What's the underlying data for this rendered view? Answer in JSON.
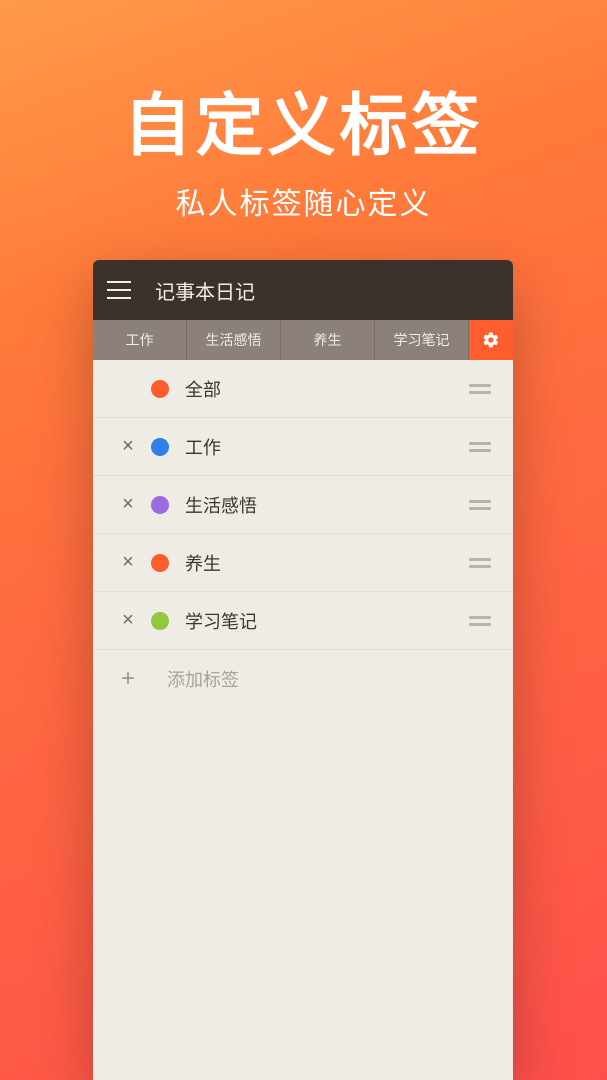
{
  "hero": {
    "title": "自定义标签",
    "subtitle": "私人标签随心定义"
  },
  "app": {
    "title": "记事本日记"
  },
  "tabs": [
    {
      "label": "工作"
    },
    {
      "label": "生活感悟"
    },
    {
      "label": "养生"
    },
    {
      "label": "学习笔记"
    }
  ],
  "tags": [
    {
      "label": "全部",
      "color": "#ff5d2e",
      "deletable": false
    },
    {
      "label": "工作",
      "color": "#2f80ed",
      "deletable": true
    },
    {
      "label": "生活感悟",
      "color": "#9b6bdf",
      "deletable": true
    },
    {
      "label": "养生",
      "color": "#ff5d2e",
      "deletable": true
    },
    {
      "label": "学习笔记",
      "color": "#8fc93a",
      "deletable": true
    }
  ],
  "addTag": {
    "label": "添加标签"
  }
}
